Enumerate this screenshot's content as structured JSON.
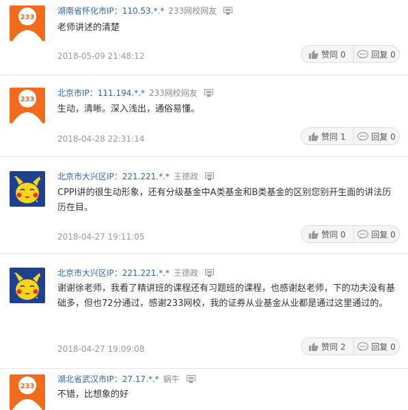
{
  "comments": [
    {
      "location": "湖南省怀化市IP：110.53.*.*",
      "username": "233网校网友",
      "avatar": "233-logo-avatar",
      "content": "老师讲述的清楚",
      "time": "2018-05-09 21:48:12",
      "like_label": "赞同 0",
      "reply_label": "回复 0"
    },
    {
      "location": "北京市IP：111.194.*.*",
      "username": "233网校网友",
      "avatar": "233-logo-avatar",
      "content": "生动，清晰。深入浅出，通俗易懂。",
      "time": "2018-04-28 22:31:14",
      "like_label": "赞同 1",
      "reply_label": "回复 0"
    },
    {
      "location": "北京市大兴区IP：221.221.*.*",
      "username": "王德政",
      "avatar": "pikachu-avatar",
      "content": "CPPI讲的很生动形象，还有分级基金中A类基金和B类基金的区别您别开生面的讲法历历在目。",
      "time": "2018-04-27 19:11:05",
      "like_label": "赞同 0",
      "reply_label": "回复 0"
    },
    {
      "location": "北京市大兴区IP：221.221.*.*",
      "username": "王德政",
      "avatar": "pikachu-avatar",
      "content": "谢谢徐老师，我看了精讲班的课程还有习题班的课程，也感谢赵老师，下的功夫没有基础多，但也72分通过，感谢233网校，我的证券从业基金从业都是通过这里通过的。",
      "time": "2018-04-27 19:09:08",
      "like_label": "赞同 2",
      "reply_label": "回复 0"
    },
    {
      "location": "湖北省武汉市IP：27.17.*.*",
      "username": "蜗牛",
      "avatar": "233-logo-avatar",
      "content": "不错，比想象的好",
      "time": "",
      "like_label": "",
      "reply_label": ""
    }
  ],
  "colors": {
    "location": "#2b66b0",
    "username": "#8c8c8c",
    "time": "#999999",
    "text": "#333333",
    "logo_orange": "#f26a1b",
    "pikachu_yellow": "#f7d51d",
    "pikachu_bg": "#1f3f8f"
  }
}
